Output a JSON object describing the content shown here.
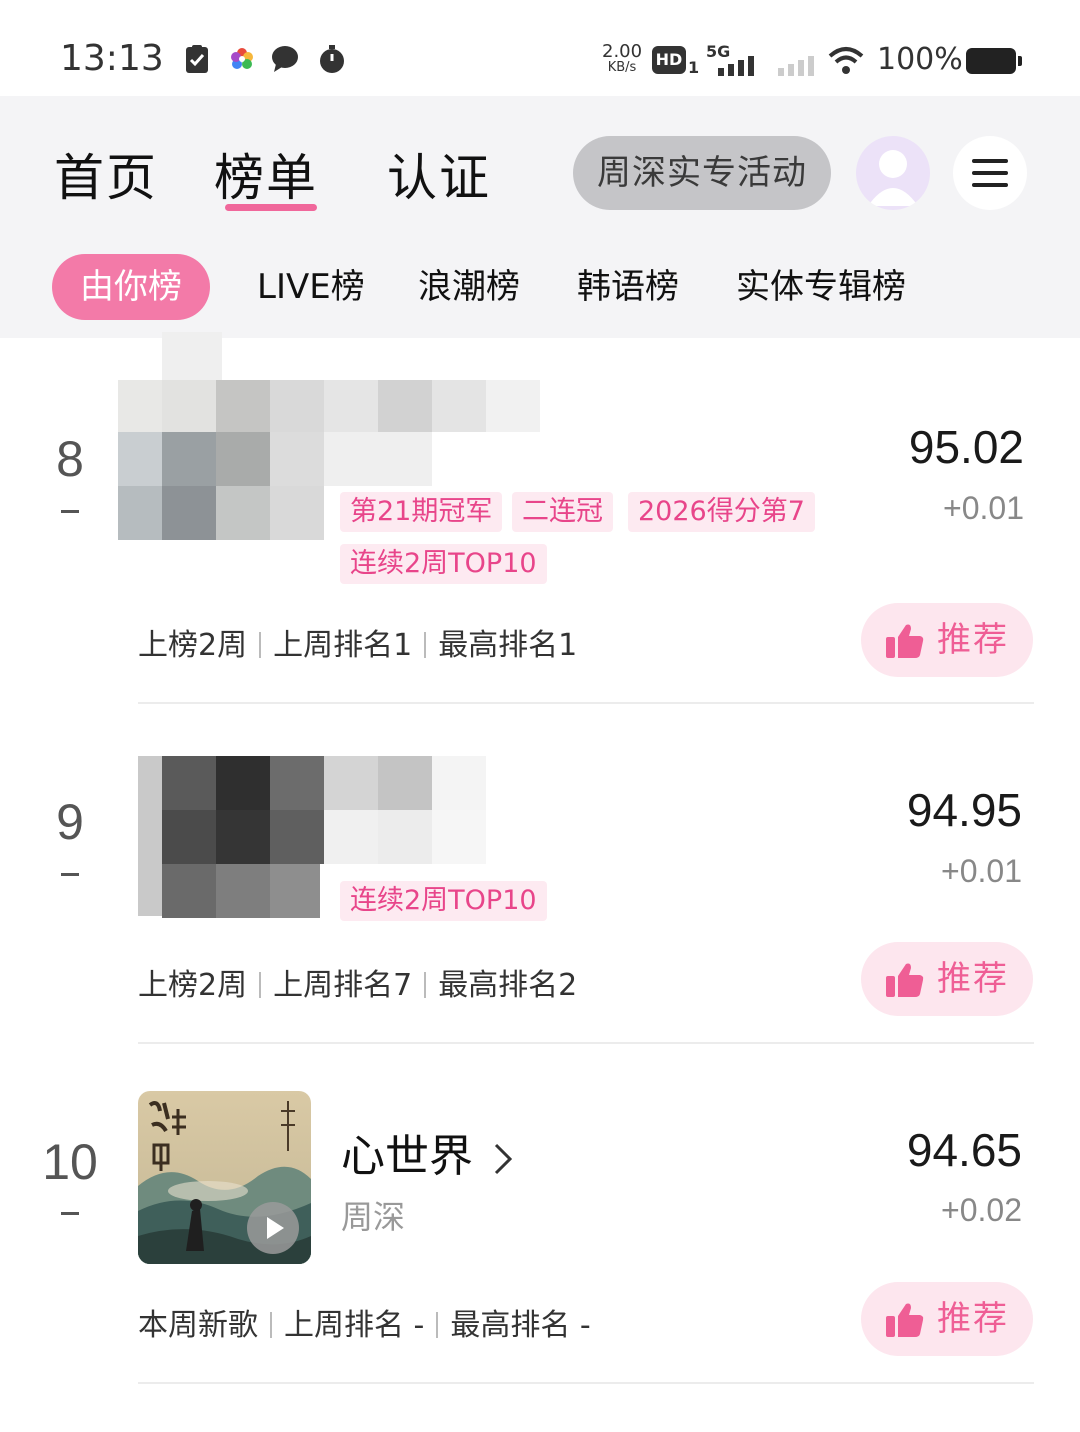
{
  "status_bar": {
    "time": "13:13",
    "speed_value": "2.00",
    "speed_unit": "KB/s",
    "hd_label": "HD",
    "hd_sub": "1",
    "network": "5G",
    "battery_text": "100%"
  },
  "nav": {
    "tabs": [
      "首页",
      "榜单",
      "认证"
    ],
    "active_tab": "榜单",
    "promo_label": "周深实专活动"
  },
  "chips": [
    "由你榜",
    "LIVE榜",
    "浪潮榜",
    "韩语榜",
    "实体专辑榜"
  ],
  "entries": [
    {
      "rank": "8",
      "score": "95.02",
      "delta": "+0.01",
      "tags": [
        "第21期冠军",
        "二连冠",
        "2026得分第7",
        "连续2周TOP10"
      ],
      "stats": [
        "上榜2周",
        "上周排名1",
        "最高排名1"
      ],
      "recommend_label": "推荐"
    },
    {
      "rank": "9",
      "score": "94.95",
      "delta": "+0.01",
      "tags": [
        "连续2周TOP10"
      ],
      "stats": [
        "上榜2周",
        "上周排名7",
        "最高排名2"
      ],
      "recommend_label": "推荐"
    },
    {
      "rank": "10",
      "title": "心世界",
      "artist": "周深",
      "score": "94.65",
      "delta": "+0.02",
      "stats": [
        "本周新歌",
        "上周排名 -",
        "最高排名 -"
      ],
      "recommend_label": "推荐"
    }
  ],
  "colors": {
    "accent": "#f37aa8",
    "tag_text": "#e8458a",
    "tag_bg": "#fdeaf1",
    "recommend_bg": "#fde6ee"
  }
}
